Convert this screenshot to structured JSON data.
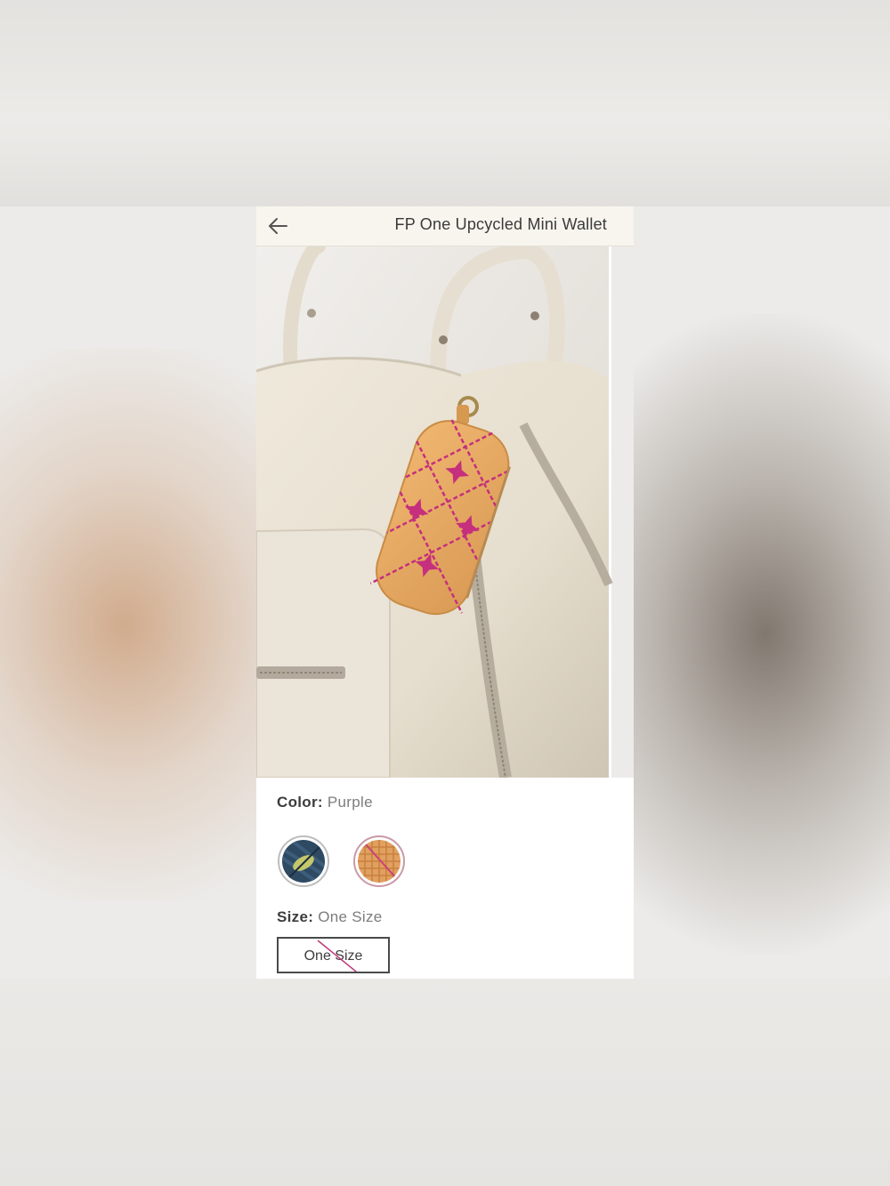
{
  "header": {
    "title": "FP One Upcycled Mini Wallet"
  },
  "options": {
    "color_label": "Color:",
    "color_value": "Purple",
    "size_label": "Size:",
    "size_value": "One Size",
    "size_button_label": "One Size"
  },
  "swatches": [
    {
      "name": "denim-swatch",
      "colors": [
        "#2e4a63",
        "#c4c86a"
      ],
      "unavailable": false
    },
    {
      "name": "orange-swatch",
      "colors": [
        "#e0a060",
        "#c93f7b"
      ],
      "unavailable": true
    }
  ],
  "colors": {
    "header_bg": "#f7f5ee",
    "bag": "#e9e2d3",
    "wallet": "#e6a65f",
    "stitch": "#c52f7d"
  },
  "icons": [
    "arrow-left-icon",
    "strike-line-icon"
  ]
}
